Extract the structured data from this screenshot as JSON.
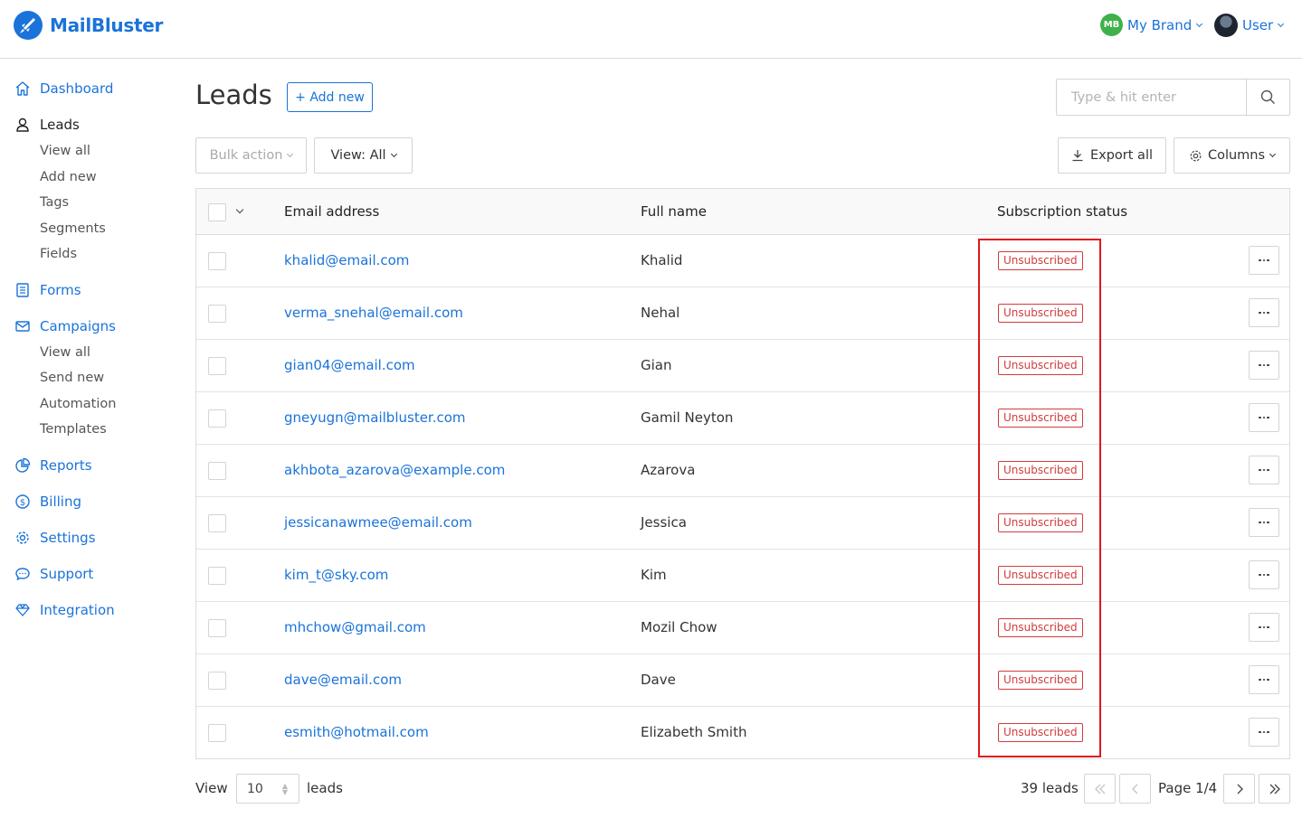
{
  "header": {
    "logo_text": "MailBluster",
    "brand_initials": "MB",
    "brand_label": "My Brand",
    "user_label": "User",
    "accent_color": "#1a73d9"
  },
  "sidebar": {
    "dashboard": "Dashboard",
    "leads": "Leads",
    "leads_sub": [
      "View all",
      "Add new",
      "Tags",
      "Segments",
      "Fields"
    ],
    "forms": "Forms",
    "campaigns": "Campaigns",
    "campaigns_sub": [
      "View all",
      "Send new",
      "Automation",
      "Templates"
    ],
    "reports": "Reports",
    "billing": "Billing",
    "settings": "Settings",
    "support": "Support",
    "integration": "Integration"
  },
  "main": {
    "title": "Leads",
    "add_new": "+ Add new",
    "search_placeholder": "Type & hit enter",
    "bulk_action": "Bulk action",
    "view_filter": "View: All",
    "export_all": "Export all",
    "columns": "Columns"
  },
  "table": {
    "headers": [
      "Email address",
      "Full name",
      "Subscription status"
    ],
    "rows": [
      {
        "email": "khalid@email.com",
        "name": "Khalid",
        "status": "Unsubscribed"
      },
      {
        "email": "verma_snehal@email.com",
        "name": "Nehal",
        "status": "Unsubscribed"
      },
      {
        "email": "gian04@email.com",
        "name": "Gian",
        "status": "Unsubscribed"
      },
      {
        "email": "gneyugn@mailbluster.com",
        "name": "Gamil Neyton",
        "status": "Unsubscribed"
      },
      {
        "email": "akhbota_azarova@example.com",
        "name": "Azarova",
        "status": "Unsubscribed"
      },
      {
        "email": "jessicanawmee@email.com",
        "name": "Jessica",
        "status": "Unsubscribed"
      },
      {
        "email": "kim_t@sky.com",
        "name": "Kim",
        "status": "Unsubscribed"
      },
      {
        "email": "mhchow@gmail.com",
        "name": "Mozil Chow",
        "status": "Unsubscribed"
      },
      {
        "email": "dave@email.com",
        "name": "Dave",
        "status": "Unsubscribed"
      },
      {
        "email": "esmith@hotmail.com",
        "name": "Elizabeth Smith",
        "status": "Unsubscribed"
      }
    ],
    "status_color": "#d23c3c",
    "highlight_color": "#e0171b"
  },
  "footer": {
    "view_label": "View",
    "per_page": "10",
    "leads_label": "leads",
    "total": "39 leads",
    "page": "Page 1/4"
  }
}
